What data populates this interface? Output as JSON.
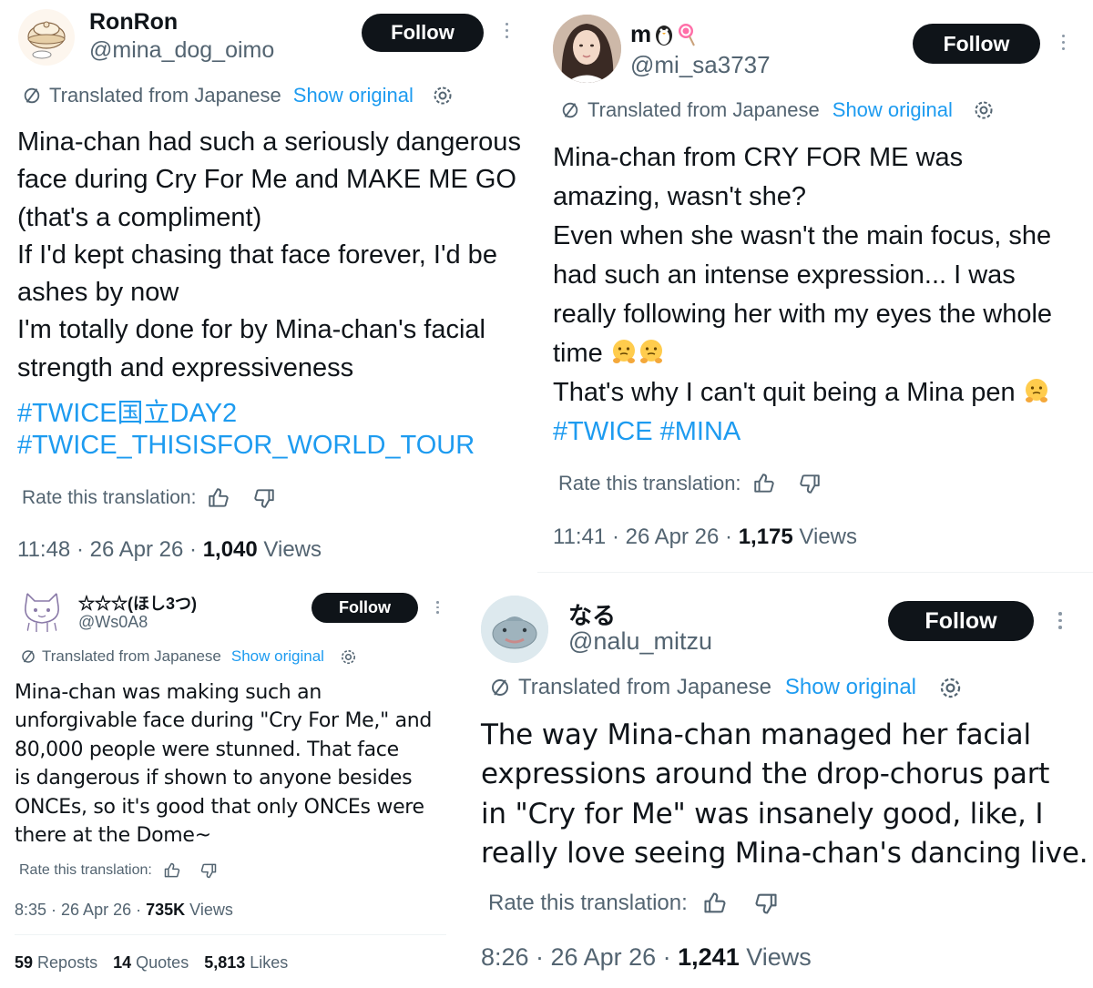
{
  "colors": {
    "text": "#0f1419",
    "muted": "#536471",
    "link": "#1d9bf0",
    "follow_bg": "#0f1419",
    "follow_text": "#ffffff"
  },
  "translation": {
    "label": "Translated from Japanese",
    "show_original": "Show original",
    "rate": "Rate this translation:",
    "views_word": "Views"
  },
  "tweets": [
    {
      "name": "RonRon",
      "handle": "@mina_dog_oimo",
      "follow": "Follow",
      "lines": [
        "Mina-chan had such a seriously dangerous",
        "face during Cry For Me and MAKE ME GO",
        "(that's a compliment)",
        "If I'd kept chasing that face forever, I'd be",
        "ashes by now",
        "I'm totally done for by Mina-chan's facial",
        "strength and expressiveness"
      ],
      "hashtags": [
        "#TWICE国立DAY2",
        "#TWICE_THISISFOR_WORLD_TOUR"
      ],
      "time": "11:48 · 26 Apr 26 · ",
      "views": "1,040"
    },
    {
      "name": "m",
      "handle": "@mi_sa3737",
      "follow": "Follow",
      "lines": [
        "Mina-chan from CRY FOR ME was",
        "amazing, wasn't she?",
        "Even when she wasn't the main focus, she",
        "had such an intense expression... I was",
        "really following her with my eyes the whole",
        "time",
        "That's why I can't quit being a Mina pen"
      ],
      "hashtags": [
        "#TWICE",
        "#MINA"
      ],
      "time": "11:41 · 26 Apr 26 · ",
      "views": "1,175"
    },
    {
      "name": "☆☆☆(ほし3つ)",
      "handle": "@Ws0A8",
      "follow": "Follow",
      "lines": [
        "Mina-chan was making such an",
        "unforgivable face during \"Cry For Me,\" and",
        "80,000 people were stunned. That face",
        "is dangerous if shown to anyone besides",
        "ONCEs, so it's good that only ONCEs were",
        "there at the Dome~"
      ],
      "time": "8:35 · 26 Apr 26 · ",
      "views": "735K",
      "stats": [
        {
          "value": "59",
          "label": "Reposts"
        },
        {
          "value": "14",
          "label": "Quotes"
        },
        {
          "value": "5,813",
          "label": "Likes"
        }
      ]
    },
    {
      "name": "なる",
      "handle": "@nalu_mitzu",
      "follow": "Follow",
      "lines": [
        "The way Mina-chan managed her facial",
        "expressions around the drop-chorus part",
        "in \"Cry for Me\" was insanely good, like, I",
        "really love seeing Mina-chan's dancing live."
      ],
      "time": "8:26 · 26 Apr 26 · ",
      "views": "1,241"
    }
  ]
}
